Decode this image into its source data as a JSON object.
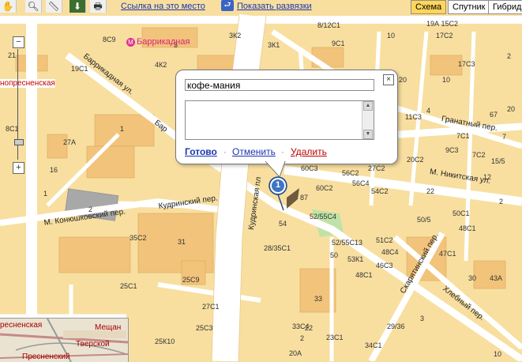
{
  "toolbar": {
    "link_here": "Ссылка на это место",
    "show_junctions": "Показать развязки",
    "layers": {
      "scheme": "Схема",
      "satellite": "Спутник",
      "hybrid": "Гибрид"
    }
  },
  "colors": {
    "block": "#f8dfa0",
    "road": "#ffffff",
    "building": "#f2c37a",
    "accent": "#ffd65a",
    "placemark": "#3f74c4"
  },
  "zoom": {
    "plus": "+",
    "minus": "−"
  },
  "metro": {
    "name": "Баррикадная",
    "icon": "М"
  },
  "edge_label": "нопресненская",
  "streets": {
    "barrikadnaya": "Баррикадная ул.",
    "barrikadnaya2": "Бар",
    "kudrinsky_per": "Кудринский пер.",
    "konyushkovsky": "М. Конюшковский пер.",
    "kudrinskaya_pl": "Кудринская пл",
    "granatny": "Гранатный пер.",
    "nikitskaya": "М. Никитская ул.",
    "skaryatinsky": "Скарятинский пер.",
    "khlebny": "Хлебный пер."
  },
  "house_numbers": [
    "8С9",
    "3К2",
    "3К1",
    "8/12С1",
    "9С1",
    "10",
    "19А 15С2",
    "17С2",
    "17С3",
    "21",
    "19С1",
    "4К2",
    "20",
    "10",
    "8С1",
    "1",
    "27А",
    "11С3",
    "7С1",
    "7",
    "9С3",
    "7С2",
    "20С2",
    "12",
    "60С3",
    "56С2",
    "27С2",
    "60С2",
    "56С4",
    "54С2",
    "22",
    "52/55С4",
    "54",
    "28/35С1",
    "52/55С13",
    "51С2",
    "48С4",
    "46С3",
    "48С1",
    "50",
    "53К1",
    "31",
    "25С1",
    "25С9",
    "27С1",
    "25С3",
    "25К10",
    "33",
    "33С4",
    "23С1",
    "29/36",
    "34С1",
    "20А",
    "10",
    "3",
    "15/5",
    "50/5",
    "50С1",
    "48С1",
    "47С1",
    "43А",
    "30",
    "2",
    "3",
    "35С2",
    "2",
    "67",
    "87",
    "1",
    "16",
    "2",
    "20",
    "4",
    "2",
    "22"
  ],
  "placemark": {
    "number": "1"
  },
  "balloon": {
    "title_value": "кофе-мания",
    "close": "×",
    "done": "Готово",
    "cancel": "Отменить",
    "delete": "Удалить",
    "sep": "·"
  },
  "minimap": {
    "l1": "Мещан",
    "l2": "Тверской",
    "l3": "Пресненский",
    "l4": "ресненская"
  }
}
